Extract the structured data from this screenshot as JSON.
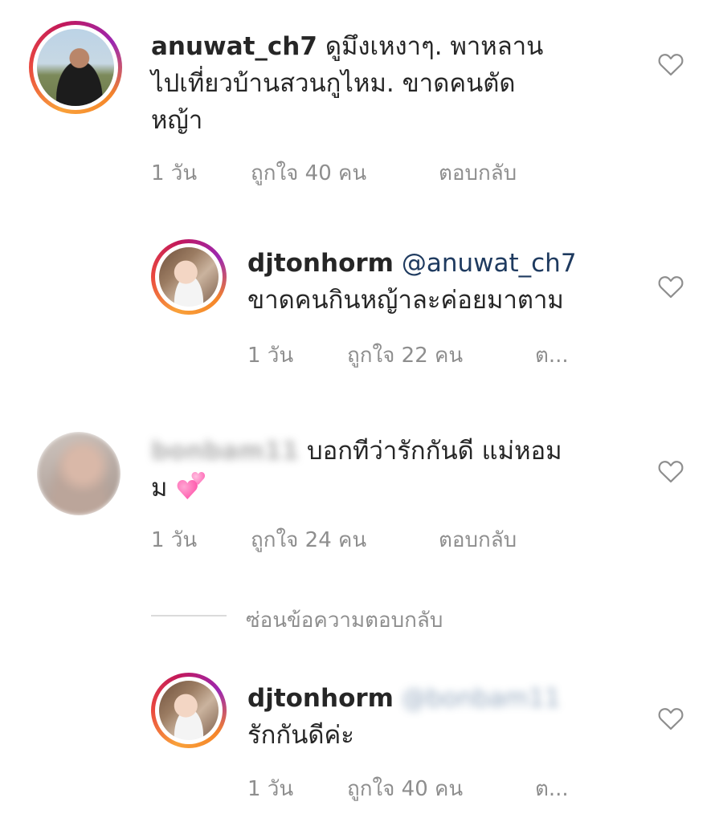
{
  "comments": [
    {
      "username": "anuwat_ch7",
      "text_line1": "ดูมึงเหงาๆ. พาหลาน",
      "text_line2": "ไปเที่ยวบ้านสวนกูไหม. ขาดคนตัด",
      "text_line3": "หญ้า",
      "time": "1 วัน",
      "likes": "ถูกใจ 40 คน",
      "reply": "ตอบกลับ"
    },
    {
      "username": "djtonhorm",
      "mention": "@anuwat_ch7",
      "text_line2": "ขาดคนกินหญ้าละค่อยมาตาม",
      "time": "1 วัน",
      "likes": "ถูกใจ 22 คน",
      "reply": "ต..."
    },
    {
      "username": "bonbam11",
      "text_line1": "บอกทีว่ารักกันดี แม่หอม",
      "text_line2": "ม",
      "time": "1 วัน",
      "likes": "ถูกใจ 24 คน",
      "reply": "ตอบกลับ"
    },
    {
      "username": "djtonhorm",
      "mention": "@bonbam11",
      "text_line2": "รักกันดีค่ะ",
      "time": "1 วัน",
      "likes": "ถูกใจ 40 คน",
      "reply": "ต..."
    }
  ],
  "hide_replies": "ซ่อนข้อความตอบกลับ",
  "icons": {
    "like": "heart-outline-icon",
    "emoji": "two-hearts-emoji"
  },
  "colors": {
    "text": "#262626",
    "secondary": "#8e8e8e",
    "mention": "#1e3a5f",
    "heart": "#8e8e8e"
  }
}
